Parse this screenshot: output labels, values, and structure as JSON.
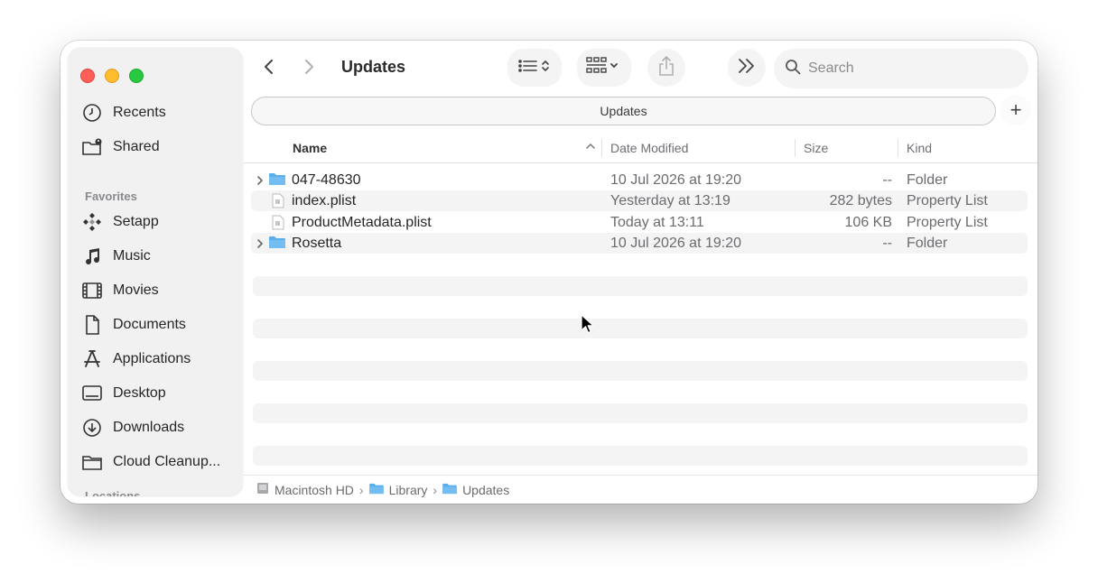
{
  "window": {
    "title": "Updates"
  },
  "toolbar": {
    "back_icon": "chevron-left-icon",
    "forward_icon": "chevron-right-icon",
    "view_icon": "list-view-icon",
    "group_icon": "grid-group-icon",
    "share_icon": "share-icon",
    "more_icon": "double-chevron-right-icon",
    "search_placeholder": "Search"
  },
  "tab": {
    "label": "Updates",
    "add_label": "+"
  },
  "sidebar": {
    "top_items": [
      {
        "label": "Recents",
        "icon": "clock-icon"
      },
      {
        "label": "Shared",
        "icon": "shared-folder-icon"
      }
    ],
    "favorites_label": "Favorites",
    "favorites": [
      {
        "label": "Setapp",
        "icon": "setapp-icon"
      },
      {
        "label": "Music",
        "icon": "music-note-icon"
      },
      {
        "label": "Movies",
        "icon": "film-icon"
      },
      {
        "label": "Documents",
        "icon": "document-icon"
      },
      {
        "label": "Applications",
        "icon": "applications-icon"
      },
      {
        "label": "Desktop",
        "icon": "desktop-icon"
      },
      {
        "label": "Downloads",
        "icon": "download-icon"
      },
      {
        "label": "Cloud Cleanup...",
        "icon": "folder-icon"
      }
    ],
    "locations_label": "Locations"
  },
  "columns": {
    "name": "Name",
    "date": "Date Modified",
    "size": "Size",
    "kind": "Kind"
  },
  "files": [
    {
      "name": "047-48630",
      "date": "10 Jul 2026 at 19:20",
      "size": "--",
      "kind": "Folder",
      "type": "folder"
    },
    {
      "name": "index.plist",
      "date": "Yesterday at 13:19",
      "size": "282 bytes",
      "kind": "Property List",
      "type": "file"
    },
    {
      "name": "ProductMetadata.plist",
      "date": "Today at 13:11",
      "size": "106 KB",
      "kind": "Property List",
      "type": "file"
    },
    {
      "name": "Rosetta",
      "date": "10 Jul 2026 at 19:20",
      "size": "--",
      "kind": "Folder",
      "type": "folder"
    }
  ],
  "path": [
    {
      "label": "Macintosh HD",
      "icon": "disk-icon"
    },
    {
      "label": "Library",
      "icon": "folder-icon"
    },
    {
      "label": "Updates",
      "icon": "folder-icon"
    }
  ],
  "colors": {
    "folder": "#5aaeec",
    "accent": "#007aff"
  }
}
